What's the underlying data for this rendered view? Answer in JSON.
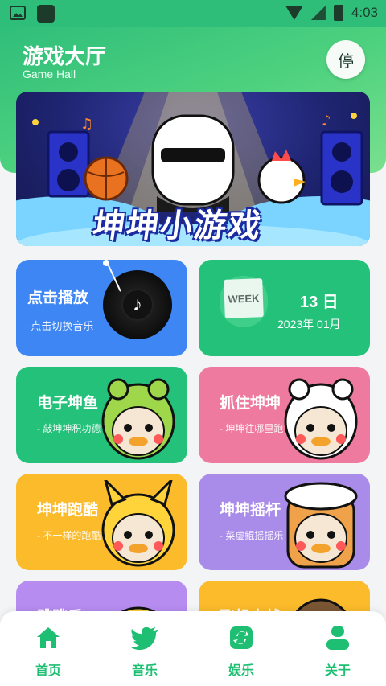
{
  "status_bar": {
    "time": "4:03"
  },
  "header": {
    "title": "游戏大厅",
    "subtitle": "Game Hall",
    "stop_label": "停"
  },
  "banner": {
    "text": "坤坤小游戏"
  },
  "music_card": {
    "title": "点击播放",
    "subtitle": "-点击切换音乐"
  },
  "date_card": {
    "week_label": "WEEK",
    "day": "13 日",
    "month": "2023年 01月"
  },
  "games": [
    {
      "title": "电子坤鱼",
      "subtitle": "- 敲坤坤积功德",
      "color": "#23c17a"
    },
    {
      "title": "抓住坤坤",
      "subtitle": "- 坤坤往哪里跑",
      "color": "#ee7aa0"
    },
    {
      "title": "坤坤跑酷",
      "subtitle": "- 不一样的跑酷",
      "color": "#fbbb2b"
    },
    {
      "title": "坤坤摇杆",
      "subtitle": "- 菜虚鲲摇摇乐",
      "color": "#a98be9"
    },
    {
      "title": "跳跳乐",
      "subtitle": "",
      "color": "#b68cf0"
    },
    {
      "title": "飞机大战",
      "subtitle": "",
      "color": "#fbbb2b"
    }
  ],
  "nav": [
    {
      "label": "首页",
      "icon": "home-icon"
    },
    {
      "label": "音乐",
      "icon": "bird-icon"
    },
    {
      "label": "娱乐",
      "icon": "refresh-icon"
    },
    {
      "label": "关于",
      "icon": "user-icon"
    }
  ],
  "colors": {
    "accent": "#1fbf73",
    "header_green": "#2fbe7a"
  }
}
